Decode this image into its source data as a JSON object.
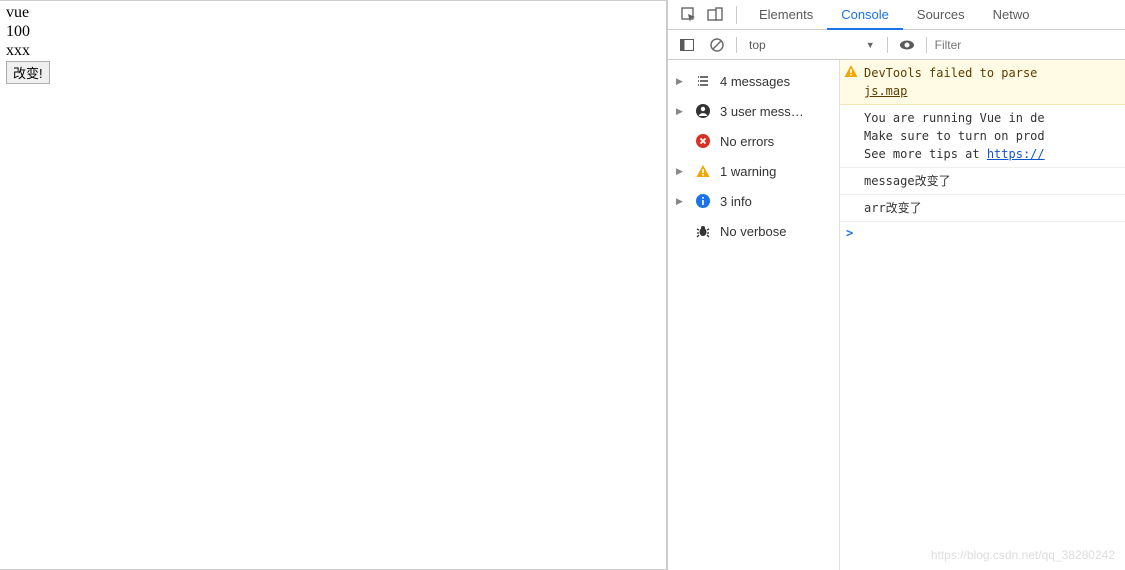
{
  "page": {
    "line1": "vue",
    "line2": "100",
    "line3": "xxx",
    "button_label": "改变!"
  },
  "tabs": {
    "elements": "Elements",
    "console": "Console",
    "sources": "Sources",
    "network": "Netwo"
  },
  "toolbar": {
    "context": "top",
    "filter_placeholder": "Filter"
  },
  "sidebar": {
    "messages": "4 messages",
    "user_messages": "3 user mess…",
    "errors": "No errors",
    "warnings": "1 warning",
    "info": "3 info",
    "verbose": "No verbose"
  },
  "console": {
    "warn_line1": "DevTools failed to parse ",
    "warn_link": "js.map",
    "vue_line1": "You are running Vue in de",
    "vue_line2": "Make sure to turn on prod",
    "vue_line3_a": "See more tips at ",
    "vue_line3_link": "https://",
    "msg1": "message改变了",
    "msg2": "arr改变了",
    "prompt": ">"
  },
  "watermark": "https://blog.csdn.net/qq_38280242"
}
